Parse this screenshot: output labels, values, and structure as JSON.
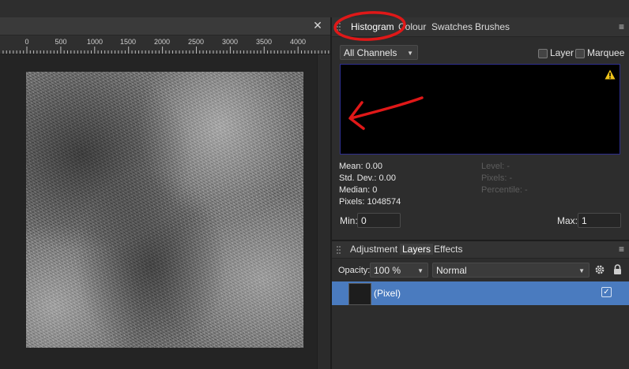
{
  "document": {
    "close_glyph": "✕",
    "ruler_labels": [
      "0",
      "500",
      "1000",
      "1500",
      "2000",
      "2500",
      "3000",
      "3500",
      "4000"
    ]
  },
  "histogram_panel": {
    "tabs": [
      "Histogram",
      "Colour",
      "Swatches",
      "Brushes"
    ],
    "active_tab": "Histogram",
    "menu_glyph": "≡",
    "channel_select": "All Channels",
    "layer_checkbox_label": "Layer",
    "marquee_checkbox_label": "Marquee",
    "warning_icon": "warning-triangle-icon",
    "stats": {
      "mean": "Mean: 0.00",
      "std_dev": "Std. Dev.: 0.00",
      "median": "Median: 0",
      "pixels": "Pixels: 1048574"
    },
    "cursor_stats": {
      "level": "Level: -",
      "pixels": "Pixels: -",
      "percentile": "Percentile: -"
    },
    "min_label": "Min:",
    "min_value": "0",
    "max_label": "Max:",
    "max_value": "1"
  },
  "layers_panel": {
    "tabs": [
      "Adjustment",
      "Layers",
      "Effects"
    ],
    "active_tab": "Layers",
    "menu_glyph": "≡",
    "opacity_label": "Opacity:",
    "opacity_value": "100 %",
    "blend_mode": "Normal",
    "layers": [
      {
        "name": "(Pixel)",
        "visible": true,
        "selected": true
      }
    ],
    "visible_glyph": "✓"
  },
  "colors": {
    "selection": "#4a7bbf",
    "annotation": "#e01818",
    "warning": "#f0c419"
  }
}
